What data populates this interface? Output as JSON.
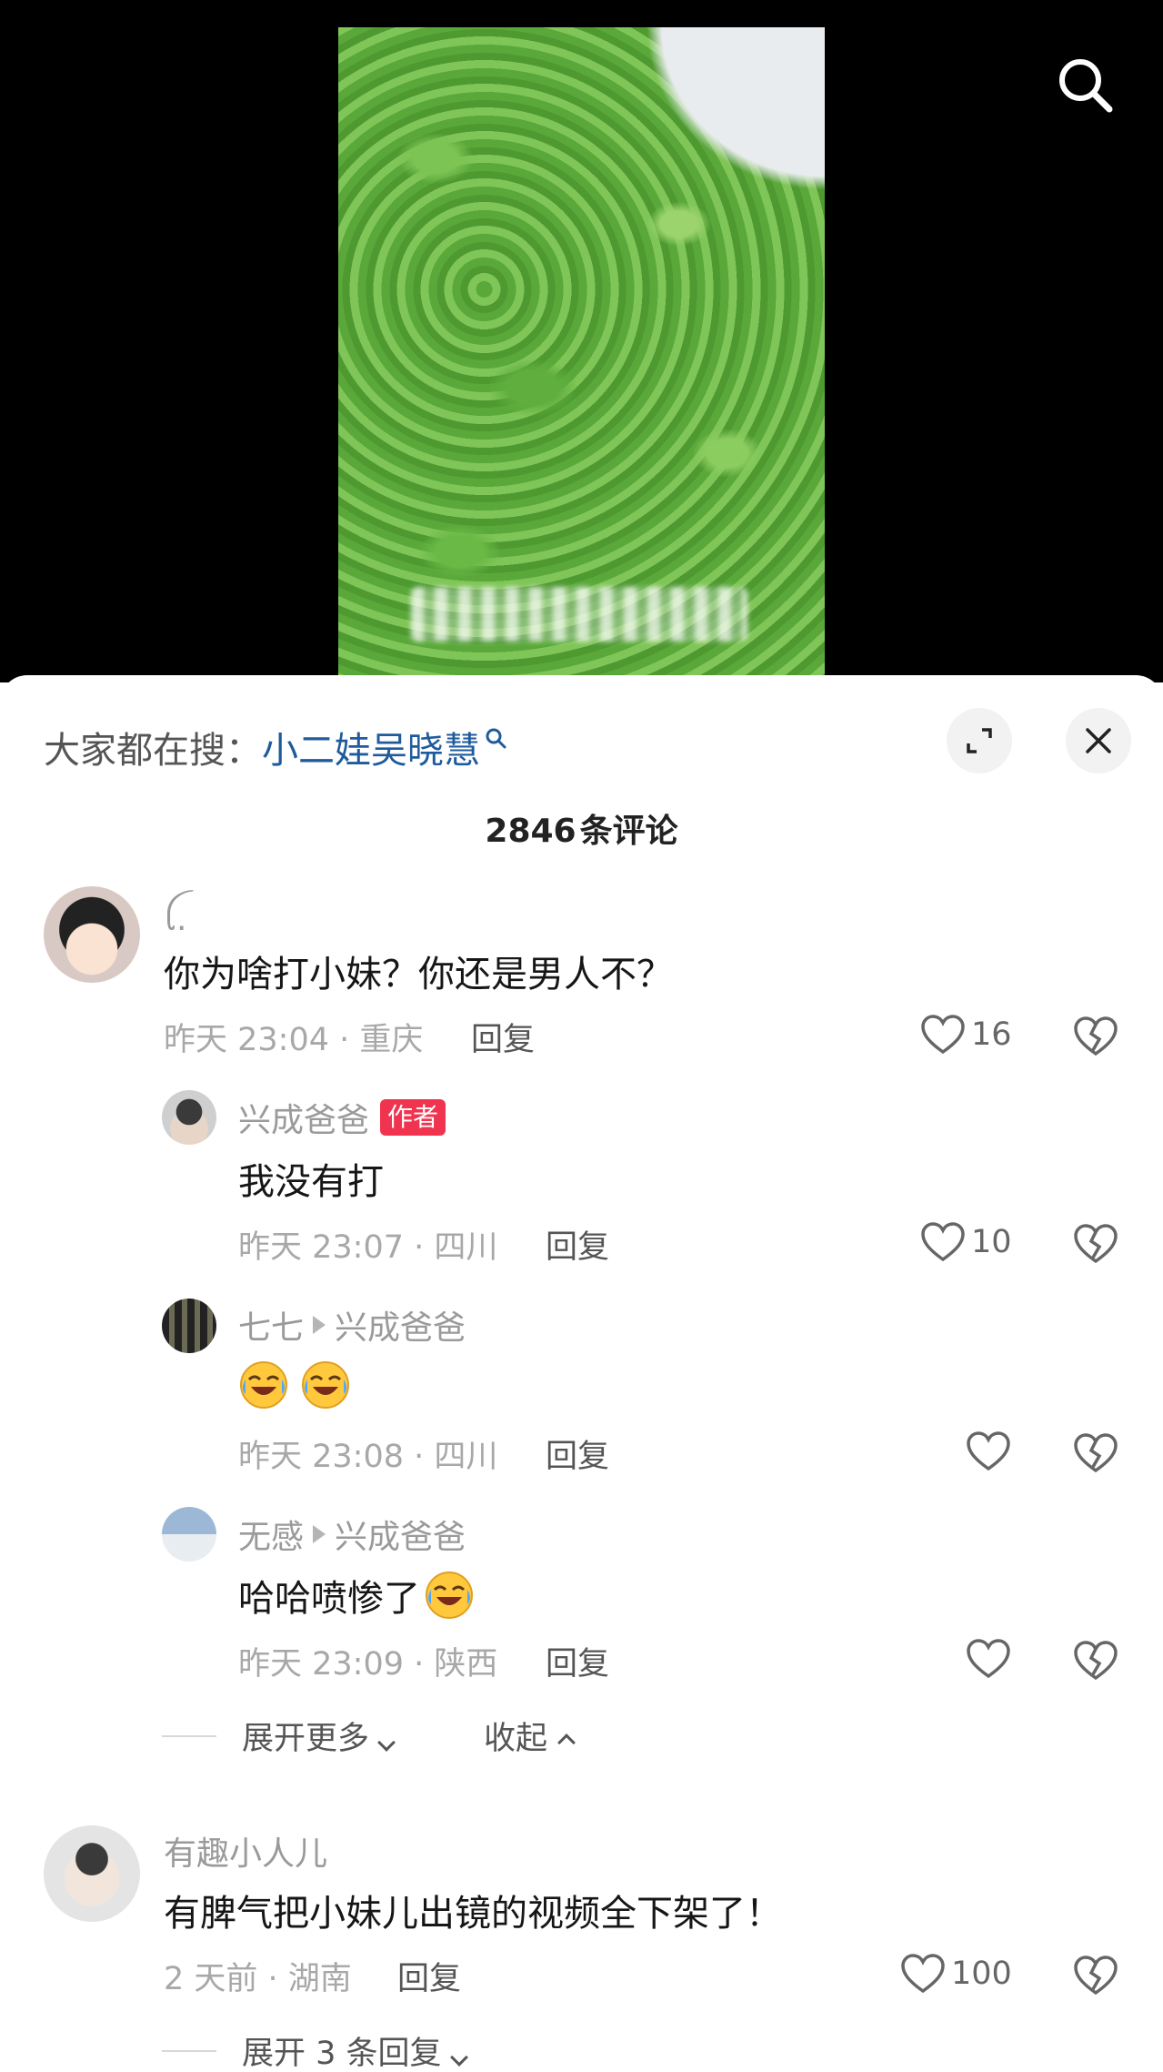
{
  "header": {
    "hot_search_prefix": "大家都在搜：",
    "hot_search_link": "小二娃吴晓慧",
    "comment_count": "2846",
    "comment_count_suffix": "条评论"
  },
  "comments": [
    {
      "user": "ꪶ.",
      "text": "你为啥打小妹？你还是男人不？",
      "time": "昨天 23:04 · 重庆",
      "reply_label": "回复",
      "likes": "16"
    },
    {
      "user": "兴成爸爸",
      "badge": "作者",
      "text": "我没有打",
      "time": "昨天 23:07 · 四川",
      "reply_label": "回复",
      "likes": "10"
    },
    {
      "user": "七七",
      "reply_to": "兴成爸爸",
      "time": "昨天 23:08 · 四川",
      "reply_label": "回复"
    },
    {
      "user": "无感",
      "reply_to": "兴成爸爸",
      "text": "哈哈喷惨了",
      "time": "昨天 23:09 · 陕西",
      "reply_label": "回复"
    },
    {
      "user": "有趣小人儿",
      "text": "有脾气把小妹儿出镜的视频全下架了！",
      "time": "2 天前 · 湖南",
      "reply_label": "回复",
      "likes": "100"
    }
  ],
  "thread_controls": {
    "expand_more": "展开更多",
    "collapse": "收起",
    "expand_replies": "展开 3 条回复"
  },
  "colors": {
    "badge": "#f0344f",
    "link": "#1f5b9c",
    "video_bg": "#000000"
  },
  "icons": [
    "search-icon",
    "expand-icon",
    "close-icon",
    "heart-icon",
    "broken-heart-icon",
    "crying-laughing-emoji"
  ]
}
